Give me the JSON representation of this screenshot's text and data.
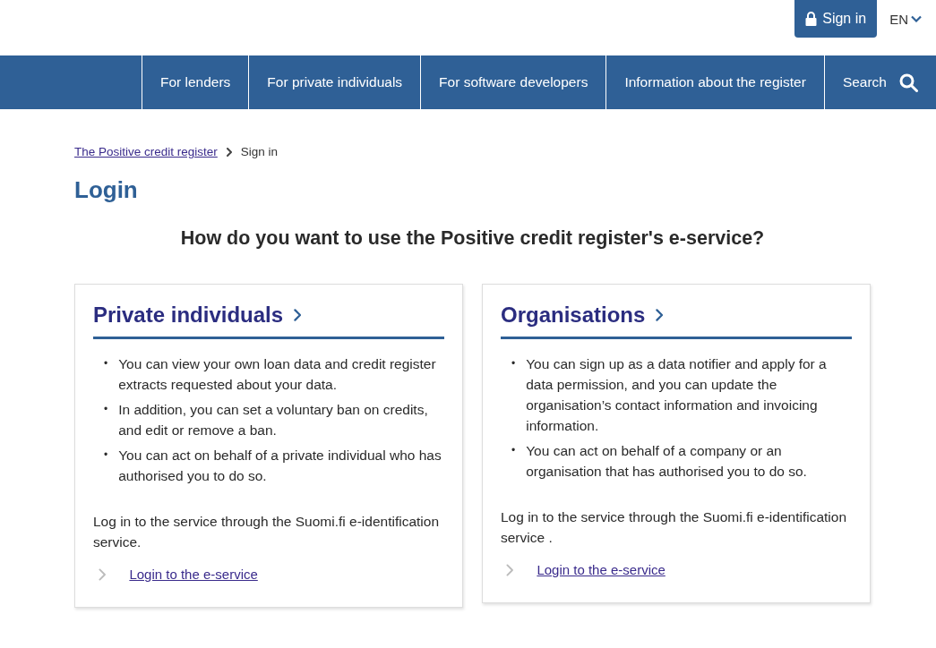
{
  "header": {
    "sign_in": "Sign in",
    "language": "EN"
  },
  "nav": {
    "items": [
      "For lenders",
      "For private individuals",
      "For software developers",
      "Information about the register"
    ],
    "search": "Search"
  },
  "breadcrumb": {
    "items": [
      {
        "label": "The Positive credit register",
        "link": true
      },
      {
        "label": "Sign in",
        "link": false
      }
    ]
  },
  "page_title": "Login",
  "question": "How do you want to use the Positive credit register's e-service?",
  "cards": [
    {
      "title": "Private individuals",
      "bullets": [
        {
          "marker": "•",
          "text": "You can view your own loan data and credit register extracts requested about your data."
        },
        {
          "marker": "•",
          "text": "In addition, you can set a voluntary ban on credits, and edit or remove a ban."
        },
        {
          "marker": "•",
          "text": "You can act on behalf of a private individual who has authorised you to do so."
        }
      ],
      "note": "Log in to the service through the Suomi.fi e-identification service.",
      "link": "Login to the e-service"
    },
    {
      "title": "Organisations",
      "bullets": [
        {
          "marker": "•",
          "text": "You can sign up as a data notifier and apply for a data permission, and you can update the organisation’s contact information and invoicing information."
        },
        {
          "marker": "•",
          "text": "You can act on behalf of a company or an organisation that has authorised you to do so."
        }
      ],
      "note": "Log in to the service through the Suomi.fi e-identification service .",
      "link": "Login to the e-service"
    }
  ]
}
